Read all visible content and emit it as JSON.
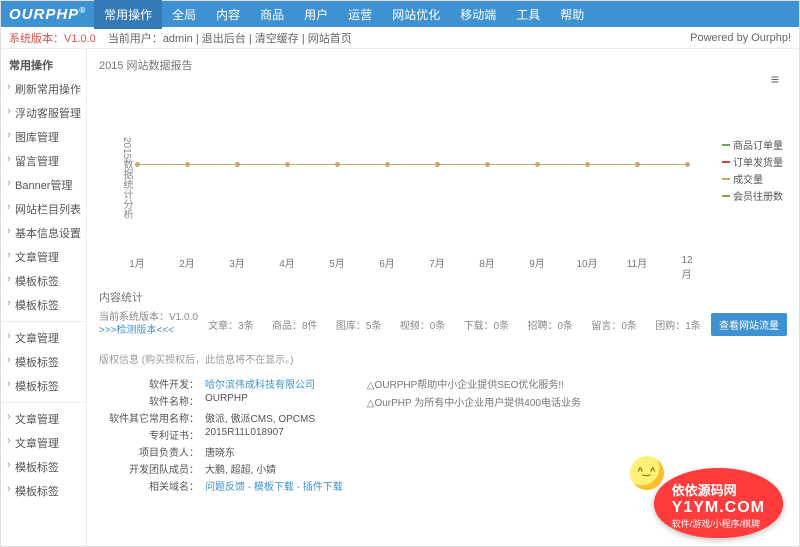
{
  "nav": {
    "brand": "OURPHP",
    "tabs": [
      "常用操作",
      "全局",
      "内容",
      "商品",
      "用户",
      "运营",
      "网站优化",
      "移动端",
      "工具",
      "帮助"
    ],
    "active": 0
  },
  "subbar": {
    "ver": "系统版本：V1.0.0",
    "user_prefix": "当前用户：",
    "user": "admin",
    "sep": " | ",
    "logout": "退出后台",
    "clear": "清空缓存",
    "home": "网站首页",
    "powered": "Powered by Ourphp!"
  },
  "sidebar": {
    "head": "常用操作",
    "g1": [
      "刷新常用操作",
      "浮动客服管理",
      "图库管理",
      "留言管理",
      "Banner管理",
      "网站栏目列表",
      "基本信息设置",
      "文章管理",
      "模板标签",
      "模板标签"
    ],
    "g2": [
      "文章管理",
      "模板标签",
      "模板标签"
    ],
    "g3": [
      "文章管理",
      "文章管理",
      "模板标签",
      "模板标签"
    ]
  },
  "chart_data": {
    "type": "line",
    "title": "2015 网站数据报告",
    "ylabel": "2015数据统计分析",
    "categories": [
      "1月",
      "2月",
      "3月",
      "4月",
      "5月",
      "6月",
      "7月",
      "8月",
      "9月",
      "10月",
      "11月",
      "12月"
    ],
    "series": [
      {
        "name": "商品订单量",
        "color": "#6aa84f",
        "values": [
          0,
          0,
          0,
          0,
          0,
          0,
          0,
          0,
          0,
          0,
          0,
          0
        ]
      },
      {
        "name": "订单发货量",
        "color": "#d23f3f",
        "values": [
          0,
          0,
          0,
          0,
          0,
          0,
          0,
          0,
          0,
          0,
          0,
          0
        ]
      },
      {
        "name": "成交量",
        "color": "#c9a86f",
        "values": [
          0,
          0,
          0,
          0,
          0,
          0,
          0,
          0,
          0,
          0,
          0,
          0
        ]
      },
      {
        "name": "会员往册数",
        "color": "#999944",
        "values": [
          0,
          0,
          0,
          0,
          0,
          0,
          0,
          0,
          0,
          0,
          0,
          0
        ]
      }
    ],
    "ylim": [
      0,
      1
    ]
  },
  "stats": {
    "head": "内容统计",
    "ver_line1": "当前系统版本：V1.0.0",
    "ver_line2": ">>>检测版本<<<",
    "cells": [
      "文章：3条",
      "商品：8件",
      "图库：5条",
      "视频：0条",
      "下载：0条",
      "招聘：0条",
      "留言：0条",
      "团购：1条"
    ],
    "btn": "查看网站流量"
  },
  "copyright": "版权信息 (购买授权后，此信息将不在显示。)",
  "info": {
    "rows": [
      {
        "k": "软件开发：",
        "v": "哈尔滨伟成科技有限公司",
        "link": true
      },
      {
        "k": "软件名称：",
        "v": "OURPHP"
      },
      {
        "k": "软件其它常用名称：",
        "v": "傲派, 傲派CMS, OPCMS"
      },
      {
        "k": "专利证书：",
        "v": "2015R11L018907"
      },
      {
        "k": "项目负责人：",
        "v": "唐晓东"
      },
      {
        "k": "开发团队成员：",
        "v": "大鹏, 超超, 小婧"
      },
      {
        "k": "相关域名：",
        "v": "问题反馈 - 模板下载 - 插件下载",
        "link": true
      }
    ],
    "promo": [
      "△OURPHP帮助中小企业提供SEO优化服务!!",
      "△OurPHP 为所有中小企业用户提供400电话业务"
    ]
  },
  "y1ym": {
    "l1": "依依源码网",
    "l2": "Y1YM.COM",
    "l3": "软件/游戏/小程序/棋牌"
  }
}
